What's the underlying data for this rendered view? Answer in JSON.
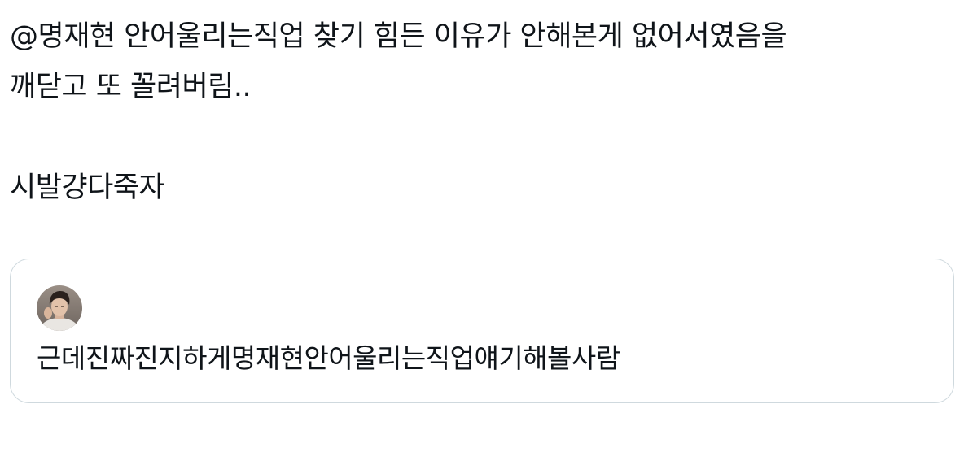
{
  "tweet": {
    "lines": [
      "@명재현 안어울리는직업 찾기 힘든 이유가 안해본게 없어서였음을",
      "깨닫고 또 꼴려버림..",
      "시발걍다죽자"
    ]
  },
  "quote": {
    "avatar_icon": "profile-photo",
    "text": "근데진짜진지하게명재현안어울리는직업얘기해볼사람"
  },
  "colors": {
    "text": "#0f1419",
    "card_border": "#cfd9de",
    "background": "#ffffff"
  }
}
